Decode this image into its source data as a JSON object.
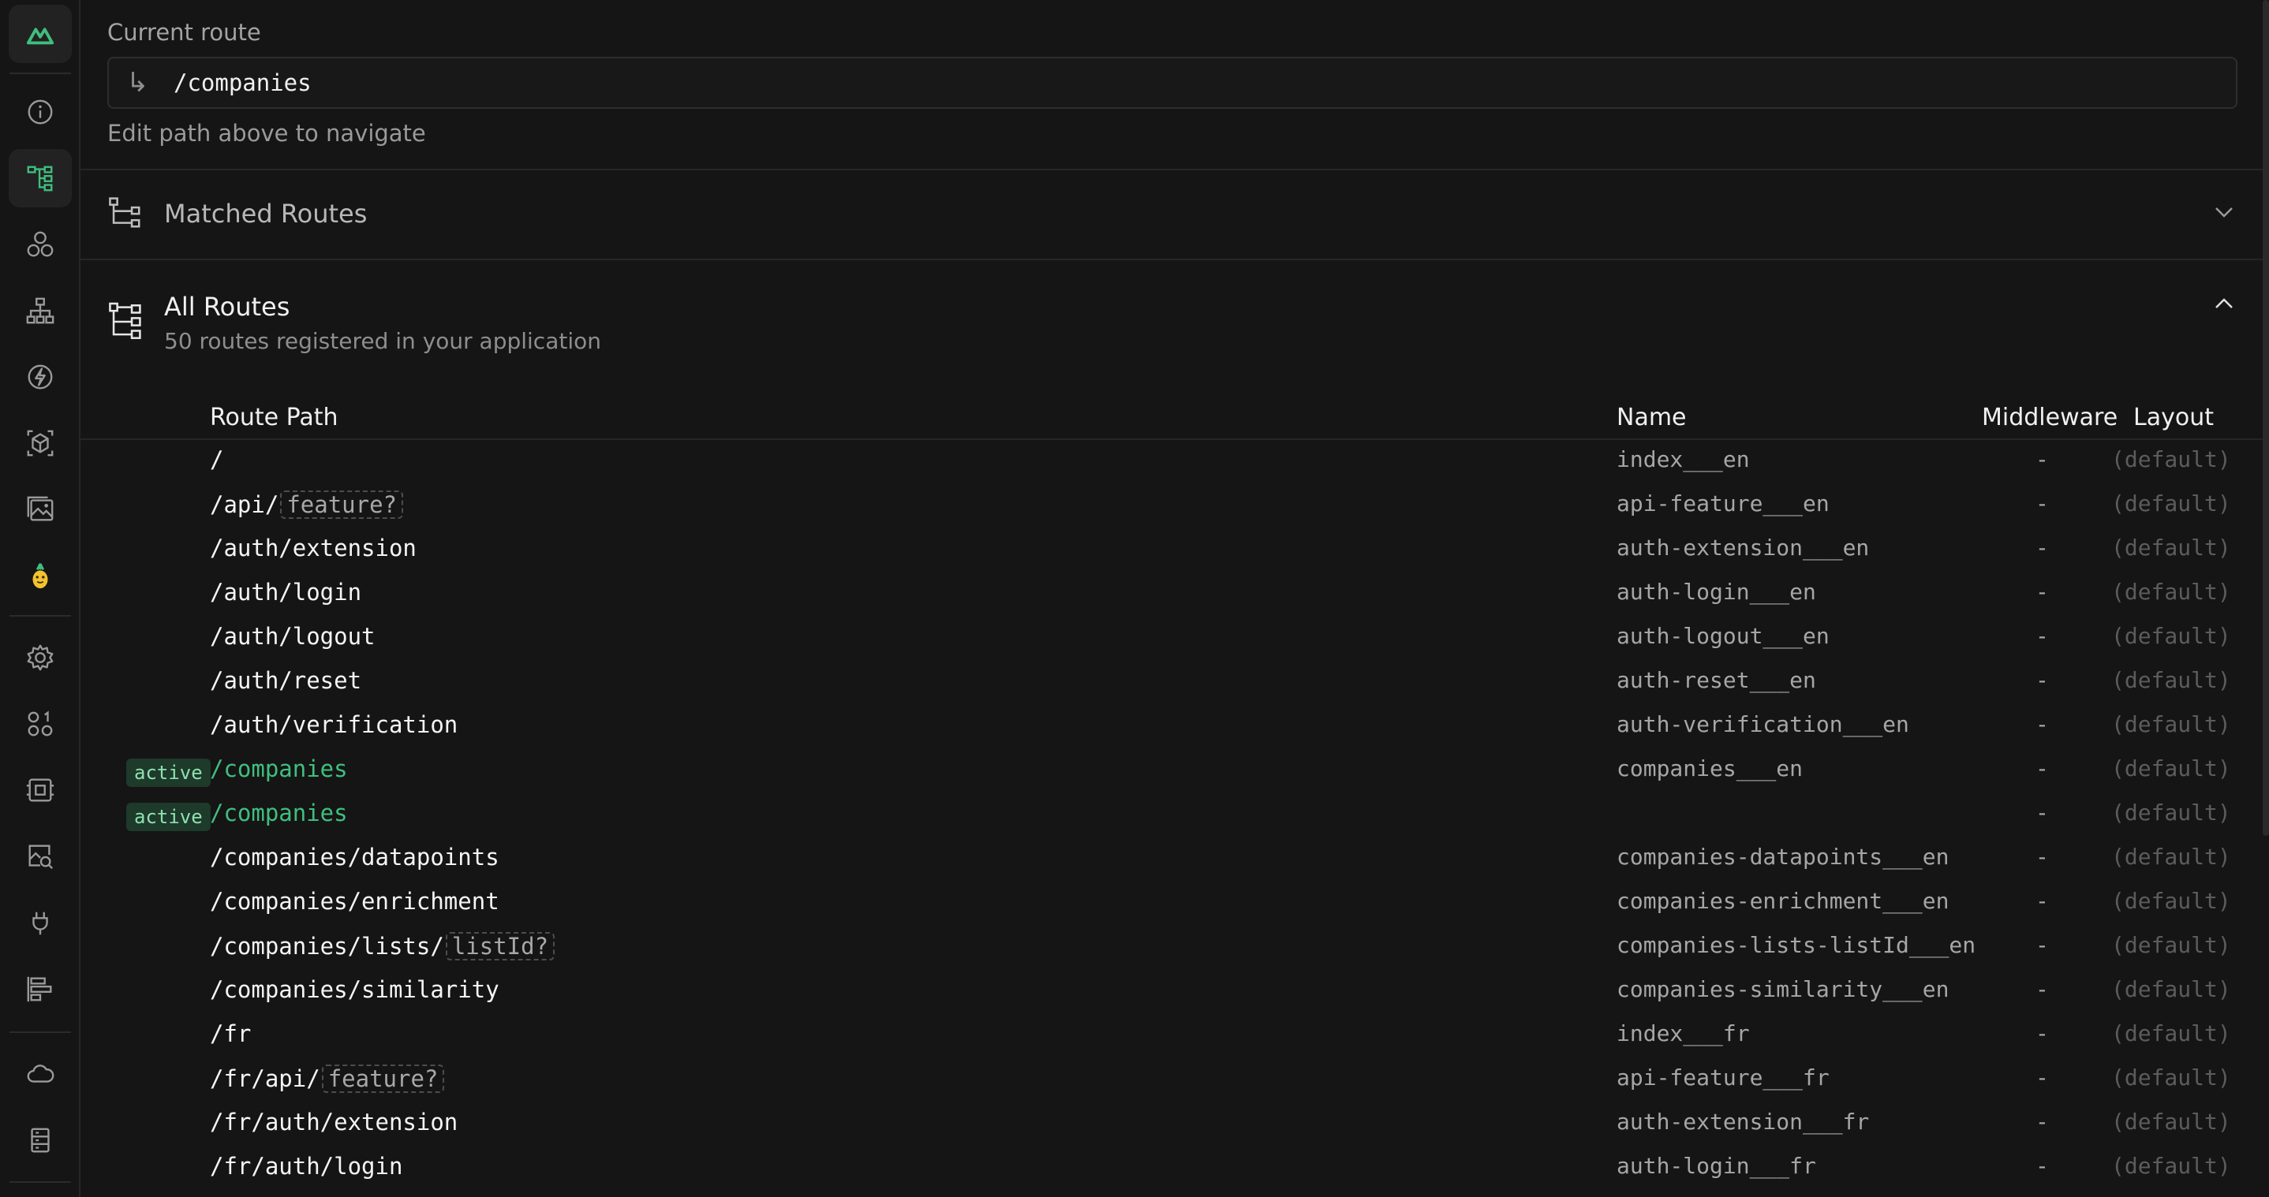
{
  "current_route": {
    "label": "Current route",
    "arrow": "↳",
    "value": "/companies",
    "hint": "Edit path above to navigate"
  },
  "matched": {
    "title": "Matched Routes"
  },
  "all_routes": {
    "title": "All Routes",
    "subtitle": "50 routes registered in your application"
  },
  "table": {
    "headers": {
      "path": "Route Path",
      "name": "Name",
      "middleware": "Middleware",
      "layout": "Layout"
    },
    "rows": [
      {
        "badge": "",
        "path": "/",
        "param": "",
        "name": "index___en",
        "middleware": "-",
        "layout": "(default)"
      },
      {
        "badge": "",
        "path": "/api/",
        "param": "feature?",
        "name": "api-feature___en",
        "middleware": "-",
        "layout": "(default)"
      },
      {
        "badge": "",
        "path": "/auth/extension",
        "param": "",
        "name": "auth-extension___en",
        "middleware": "-",
        "layout": "(default)"
      },
      {
        "badge": "",
        "path": "/auth/login",
        "param": "",
        "name": "auth-login___en",
        "middleware": "-",
        "layout": "(default)"
      },
      {
        "badge": "",
        "path": "/auth/logout",
        "param": "",
        "name": "auth-logout___en",
        "middleware": "-",
        "layout": "(default)"
      },
      {
        "badge": "",
        "path": "/auth/reset",
        "param": "",
        "name": "auth-reset___en",
        "middleware": "-",
        "layout": "(default)"
      },
      {
        "badge": "",
        "path": "/auth/verification",
        "param": "",
        "name": "auth-verification___en",
        "middleware": "-",
        "layout": "(default)"
      },
      {
        "badge": "active",
        "path": "/companies",
        "param": "",
        "name": "companies___en",
        "middleware": "-",
        "layout": "(default)"
      },
      {
        "badge": "active",
        "path": "/companies",
        "param": "",
        "name": "",
        "middleware": "-",
        "layout": "(default)"
      },
      {
        "badge": "",
        "path": "/companies/datapoints",
        "param": "",
        "name": "companies-datapoints___en",
        "middleware": "-",
        "layout": "(default)"
      },
      {
        "badge": "",
        "path": "/companies/enrichment",
        "param": "",
        "name": "companies-enrichment___en",
        "middleware": "-",
        "layout": "(default)"
      },
      {
        "badge": "",
        "path": "/companies/lists/",
        "param": "listId?",
        "name": "companies-lists-listId___en",
        "middleware": "-",
        "layout": "(default)"
      },
      {
        "badge": "",
        "path": "/companies/similarity",
        "param": "",
        "name": "companies-similarity___en",
        "middleware": "-",
        "layout": "(default)"
      },
      {
        "badge": "",
        "path": "/fr",
        "param": "",
        "name": "index___fr",
        "middleware": "-",
        "layout": "(default)"
      },
      {
        "badge": "",
        "path": "/fr/api/",
        "param": "feature?",
        "name": "api-feature___fr",
        "middleware": "-",
        "layout": "(default)"
      },
      {
        "badge": "",
        "path": "/fr/auth/extension",
        "param": "",
        "name": "auth-extension___fr",
        "middleware": "-",
        "layout": "(default)"
      },
      {
        "badge": "",
        "path": "/fr/auth/login",
        "param": "",
        "name": "auth-login___fr",
        "middleware": "-",
        "layout": "(default)"
      }
    ]
  },
  "sidebar": {
    "icons": [
      "nuxt-logo-icon",
      "info-icon",
      "route-tree-icon",
      "components-icon",
      "hierarchy-icon",
      "lightning-icon",
      "cube-icon",
      "image-icon",
      "pineapple-icon",
      "settings-icon",
      "numbers-icon",
      "chip-icon",
      "image-search-icon",
      "plug-icon",
      "timeline-icon",
      "cloud-icon",
      "storage-icon"
    ]
  },
  "colors": {
    "accent": "#3fbf7f",
    "background": "#151515",
    "badge_bg": "#1d3a2b"
  }
}
